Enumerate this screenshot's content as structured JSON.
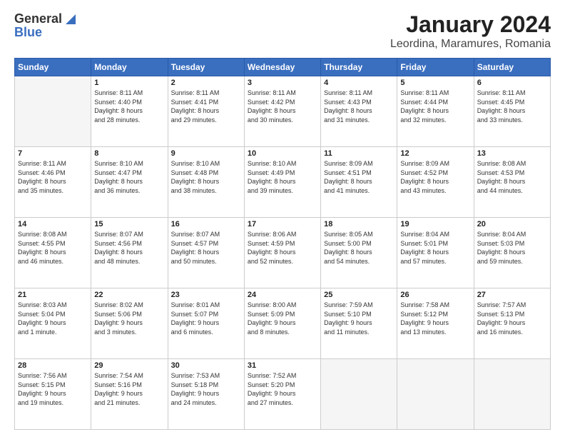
{
  "logo": {
    "general": "General",
    "blue": "Blue"
  },
  "title": "January 2024",
  "subtitle": "Leordina, Maramures, Romania",
  "header_days": [
    "Sunday",
    "Monday",
    "Tuesday",
    "Wednesday",
    "Thursday",
    "Friday",
    "Saturday"
  ],
  "weeks": [
    [
      {
        "day": "",
        "info": ""
      },
      {
        "day": "1",
        "info": "Sunrise: 8:11 AM\nSunset: 4:40 PM\nDaylight: 8 hours\nand 28 minutes."
      },
      {
        "day": "2",
        "info": "Sunrise: 8:11 AM\nSunset: 4:41 PM\nDaylight: 8 hours\nand 29 minutes."
      },
      {
        "day": "3",
        "info": "Sunrise: 8:11 AM\nSunset: 4:42 PM\nDaylight: 8 hours\nand 30 minutes."
      },
      {
        "day": "4",
        "info": "Sunrise: 8:11 AM\nSunset: 4:43 PM\nDaylight: 8 hours\nand 31 minutes."
      },
      {
        "day": "5",
        "info": "Sunrise: 8:11 AM\nSunset: 4:44 PM\nDaylight: 8 hours\nand 32 minutes."
      },
      {
        "day": "6",
        "info": "Sunrise: 8:11 AM\nSunset: 4:45 PM\nDaylight: 8 hours\nand 33 minutes."
      }
    ],
    [
      {
        "day": "7",
        "info": "Sunrise: 8:11 AM\nSunset: 4:46 PM\nDaylight: 8 hours\nand 35 minutes."
      },
      {
        "day": "8",
        "info": "Sunrise: 8:10 AM\nSunset: 4:47 PM\nDaylight: 8 hours\nand 36 minutes."
      },
      {
        "day": "9",
        "info": "Sunrise: 8:10 AM\nSunset: 4:48 PM\nDaylight: 8 hours\nand 38 minutes."
      },
      {
        "day": "10",
        "info": "Sunrise: 8:10 AM\nSunset: 4:49 PM\nDaylight: 8 hours\nand 39 minutes."
      },
      {
        "day": "11",
        "info": "Sunrise: 8:09 AM\nSunset: 4:51 PM\nDaylight: 8 hours\nand 41 minutes."
      },
      {
        "day": "12",
        "info": "Sunrise: 8:09 AM\nSunset: 4:52 PM\nDaylight: 8 hours\nand 43 minutes."
      },
      {
        "day": "13",
        "info": "Sunrise: 8:08 AM\nSunset: 4:53 PM\nDaylight: 8 hours\nand 44 minutes."
      }
    ],
    [
      {
        "day": "14",
        "info": "Sunrise: 8:08 AM\nSunset: 4:55 PM\nDaylight: 8 hours\nand 46 minutes."
      },
      {
        "day": "15",
        "info": "Sunrise: 8:07 AM\nSunset: 4:56 PM\nDaylight: 8 hours\nand 48 minutes."
      },
      {
        "day": "16",
        "info": "Sunrise: 8:07 AM\nSunset: 4:57 PM\nDaylight: 8 hours\nand 50 minutes."
      },
      {
        "day": "17",
        "info": "Sunrise: 8:06 AM\nSunset: 4:59 PM\nDaylight: 8 hours\nand 52 minutes."
      },
      {
        "day": "18",
        "info": "Sunrise: 8:05 AM\nSunset: 5:00 PM\nDaylight: 8 hours\nand 54 minutes."
      },
      {
        "day": "19",
        "info": "Sunrise: 8:04 AM\nSunset: 5:01 PM\nDaylight: 8 hours\nand 57 minutes."
      },
      {
        "day": "20",
        "info": "Sunrise: 8:04 AM\nSunset: 5:03 PM\nDaylight: 8 hours\nand 59 minutes."
      }
    ],
    [
      {
        "day": "21",
        "info": "Sunrise: 8:03 AM\nSunset: 5:04 PM\nDaylight: 9 hours\nand 1 minute."
      },
      {
        "day": "22",
        "info": "Sunrise: 8:02 AM\nSunset: 5:06 PM\nDaylight: 9 hours\nand 3 minutes."
      },
      {
        "day": "23",
        "info": "Sunrise: 8:01 AM\nSunset: 5:07 PM\nDaylight: 9 hours\nand 6 minutes."
      },
      {
        "day": "24",
        "info": "Sunrise: 8:00 AM\nSunset: 5:09 PM\nDaylight: 9 hours\nand 8 minutes."
      },
      {
        "day": "25",
        "info": "Sunrise: 7:59 AM\nSunset: 5:10 PM\nDaylight: 9 hours\nand 11 minutes."
      },
      {
        "day": "26",
        "info": "Sunrise: 7:58 AM\nSunset: 5:12 PM\nDaylight: 9 hours\nand 13 minutes."
      },
      {
        "day": "27",
        "info": "Sunrise: 7:57 AM\nSunset: 5:13 PM\nDaylight: 9 hours\nand 16 minutes."
      }
    ],
    [
      {
        "day": "28",
        "info": "Sunrise: 7:56 AM\nSunset: 5:15 PM\nDaylight: 9 hours\nand 19 minutes."
      },
      {
        "day": "29",
        "info": "Sunrise: 7:54 AM\nSunset: 5:16 PM\nDaylight: 9 hours\nand 21 minutes."
      },
      {
        "day": "30",
        "info": "Sunrise: 7:53 AM\nSunset: 5:18 PM\nDaylight: 9 hours\nand 24 minutes."
      },
      {
        "day": "31",
        "info": "Sunrise: 7:52 AM\nSunset: 5:20 PM\nDaylight: 9 hours\nand 27 minutes."
      },
      {
        "day": "",
        "info": ""
      },
      {
        "day": "",
        "info": ""
      },
      {
        "day": "",
        "info": ""
      }
    ]
  ]
}
